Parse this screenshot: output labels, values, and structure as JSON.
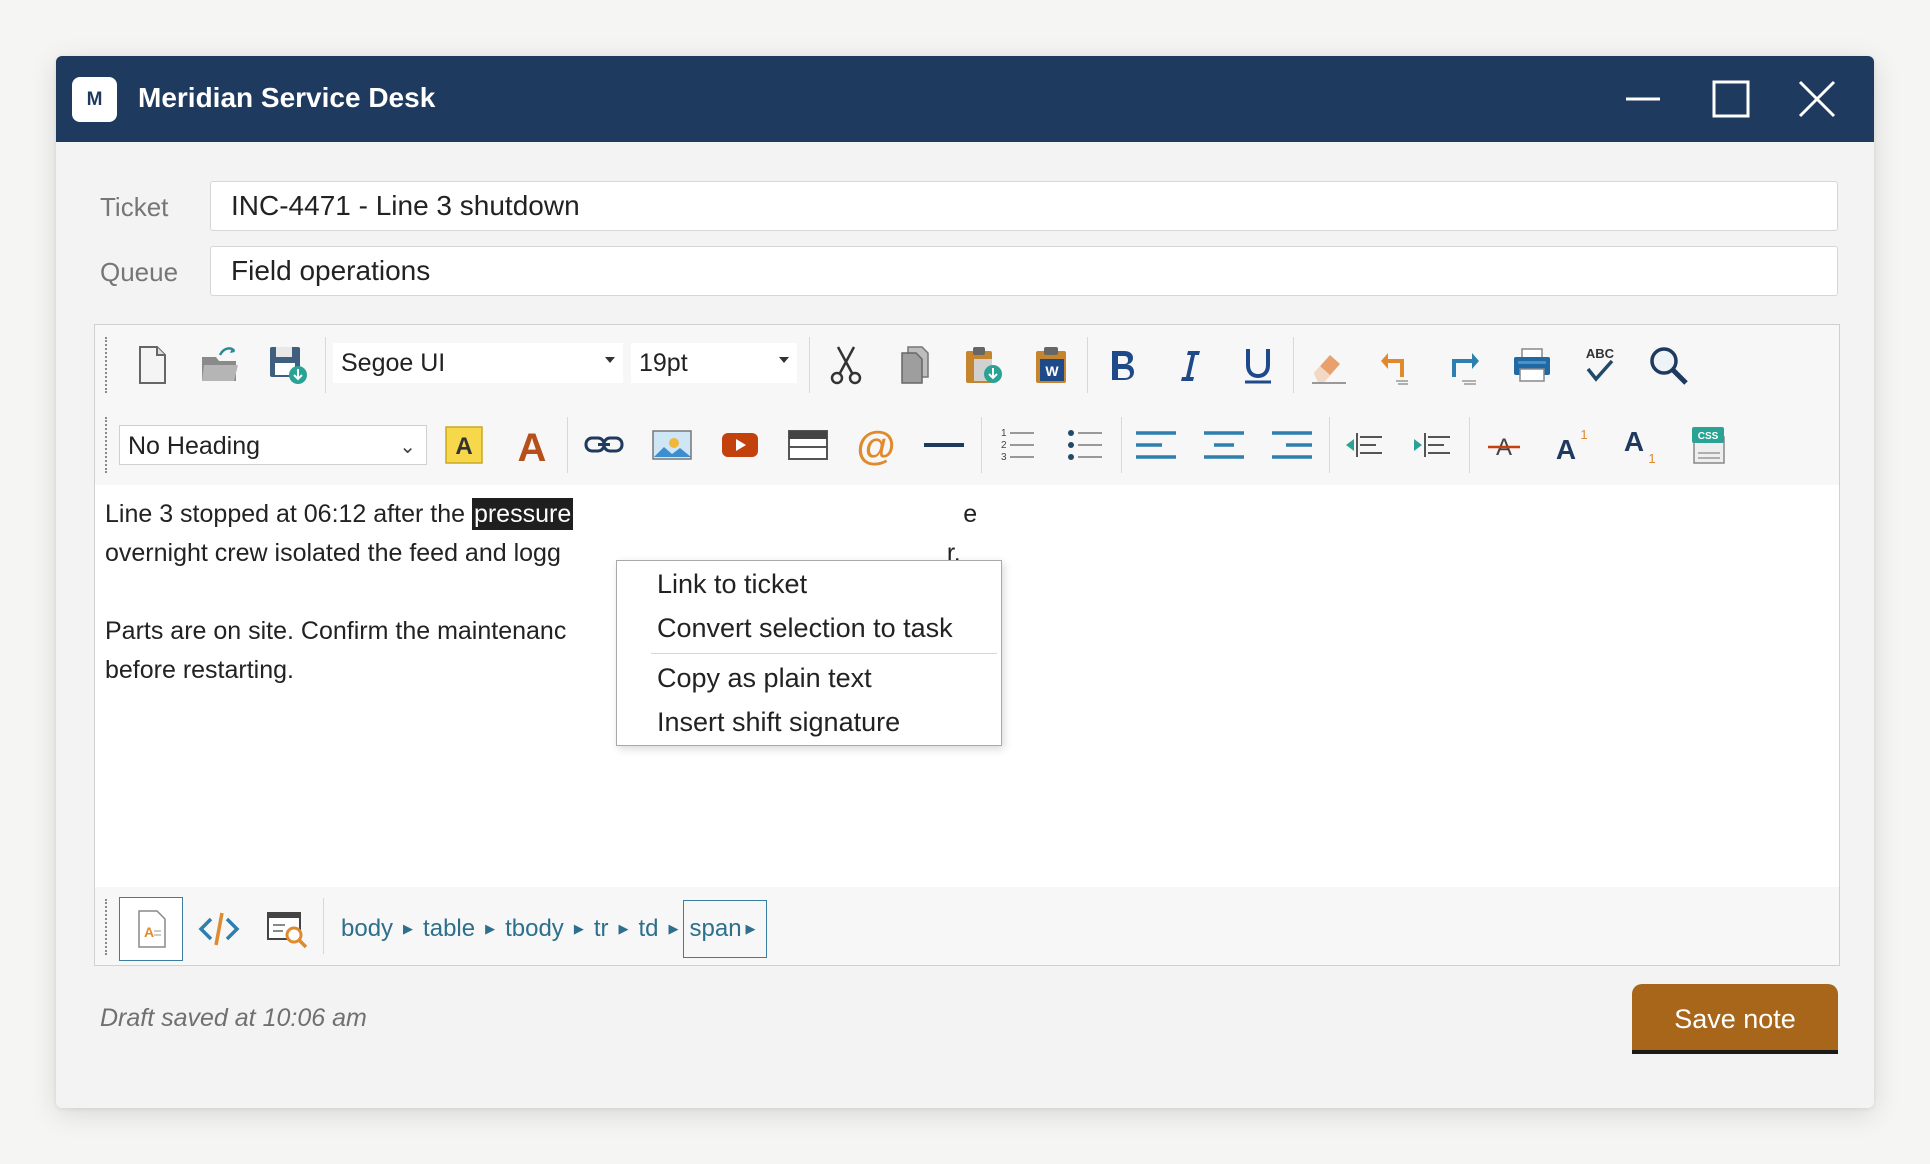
{
  "window": {
    "app_icon_letter": "M",
    "title": "Meridian Service Desk"
  },
  "ticket": {
    "label": "Ticket",
    "value": "INC-4471 - Line 3 shutdown"
  },
  "queue": {
    "label": "Queue",
    "value": "Field operations"
  },
  "toolbar": {
    "font_family": "Segoe UI",
    "font_size": "19pt",
    "heading": "No Heading",
    "icons_row1": [
      "new-document",
      "open-folder",
      "save",
      "cut",
      "copy",
      "paste",
      "paste-from-word",
      "bold",
      "italic",
      "underline",
      "clear-formatting",
      "undo",
      "redo",
      "print",
      "spellcheck",
      "find"
    ],
    "icons_row2": [
      "highlight-color",
      "font-color",
      "link",
      "image",
      "video",
      "table",
      "email-link",
      "horizontal-rule",
      "numbered-list",
      "bulleted-list",
      "align-left",
      "align-center",
      "align-right",
      "outdent",
      "indent",
      "strikethrough",
      "superscript",
      "subscript",
      "css"
    ],
    "spellcheck_text": "ABC",
    "css_text": "CSS",
    "word_badge": "W"
  },
  "content": {
    "p1_before": "Line 3 stopped at 06:12 after the ",
    "p1_selected": "pressure",
    "p1_tail1": "e",
    "p1_line2": "overnight crew isolated the feed and logg",
    "p1_tail2": "r.",
    "p2_line1": "Parts are on site. Confirm the maintenanc",
    "p2_line2": "before restarting."
  },
  "context_menu": {
    "items": [
      "Link to ticket",
      "Convert selection to task",
      "Copy as plain text",
      "Insert shift signature"
    ]
  },
  "statusbar": {
    "modes": [
      "design-view",
      "html-view",
      "preview"
    ],
    "breadcrumbs": [
      "body",
      "table",
      "tbody",
      "tr",
      "td",
      "span"
    ]
  },
  "footer": {
    "draft_status": "Draft saved at 10:06 am",
    "save_label": "Save note"
  },
  "colors": {
    "titlebar": "#1f3a5f",
    "accent": "#a8661a",
    "link": "#2d6f8c"
  }
}
